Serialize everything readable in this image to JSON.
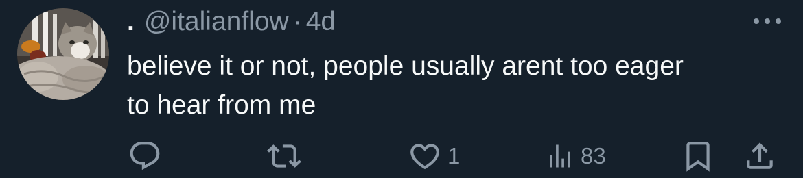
{
  "tweet": {
    "display_name": ".",
    "handle": "@italianflow",
    "separator": "·",
    "time": "4d",
    "text": "believe it or not, people usually arent too eager\nto hear from me"
  },
  "actions": {
    "reply_icon": "reply-icon",
    "retweet_icon": "retweet-icon",
    "like_icon": "heart-icon",
    "like_count": "1",
    "views_icon": "views-chart-icon",
    "views_count": "83",
    "bookmark_icon": "bookmark-icon",
    "share_icon": "share-icon"
  },
  "colors": {
    "background": "#15202b",
    "primary_text": "#f7f9f9",
    "secondary_text": "#8b98a5"
  }
}
